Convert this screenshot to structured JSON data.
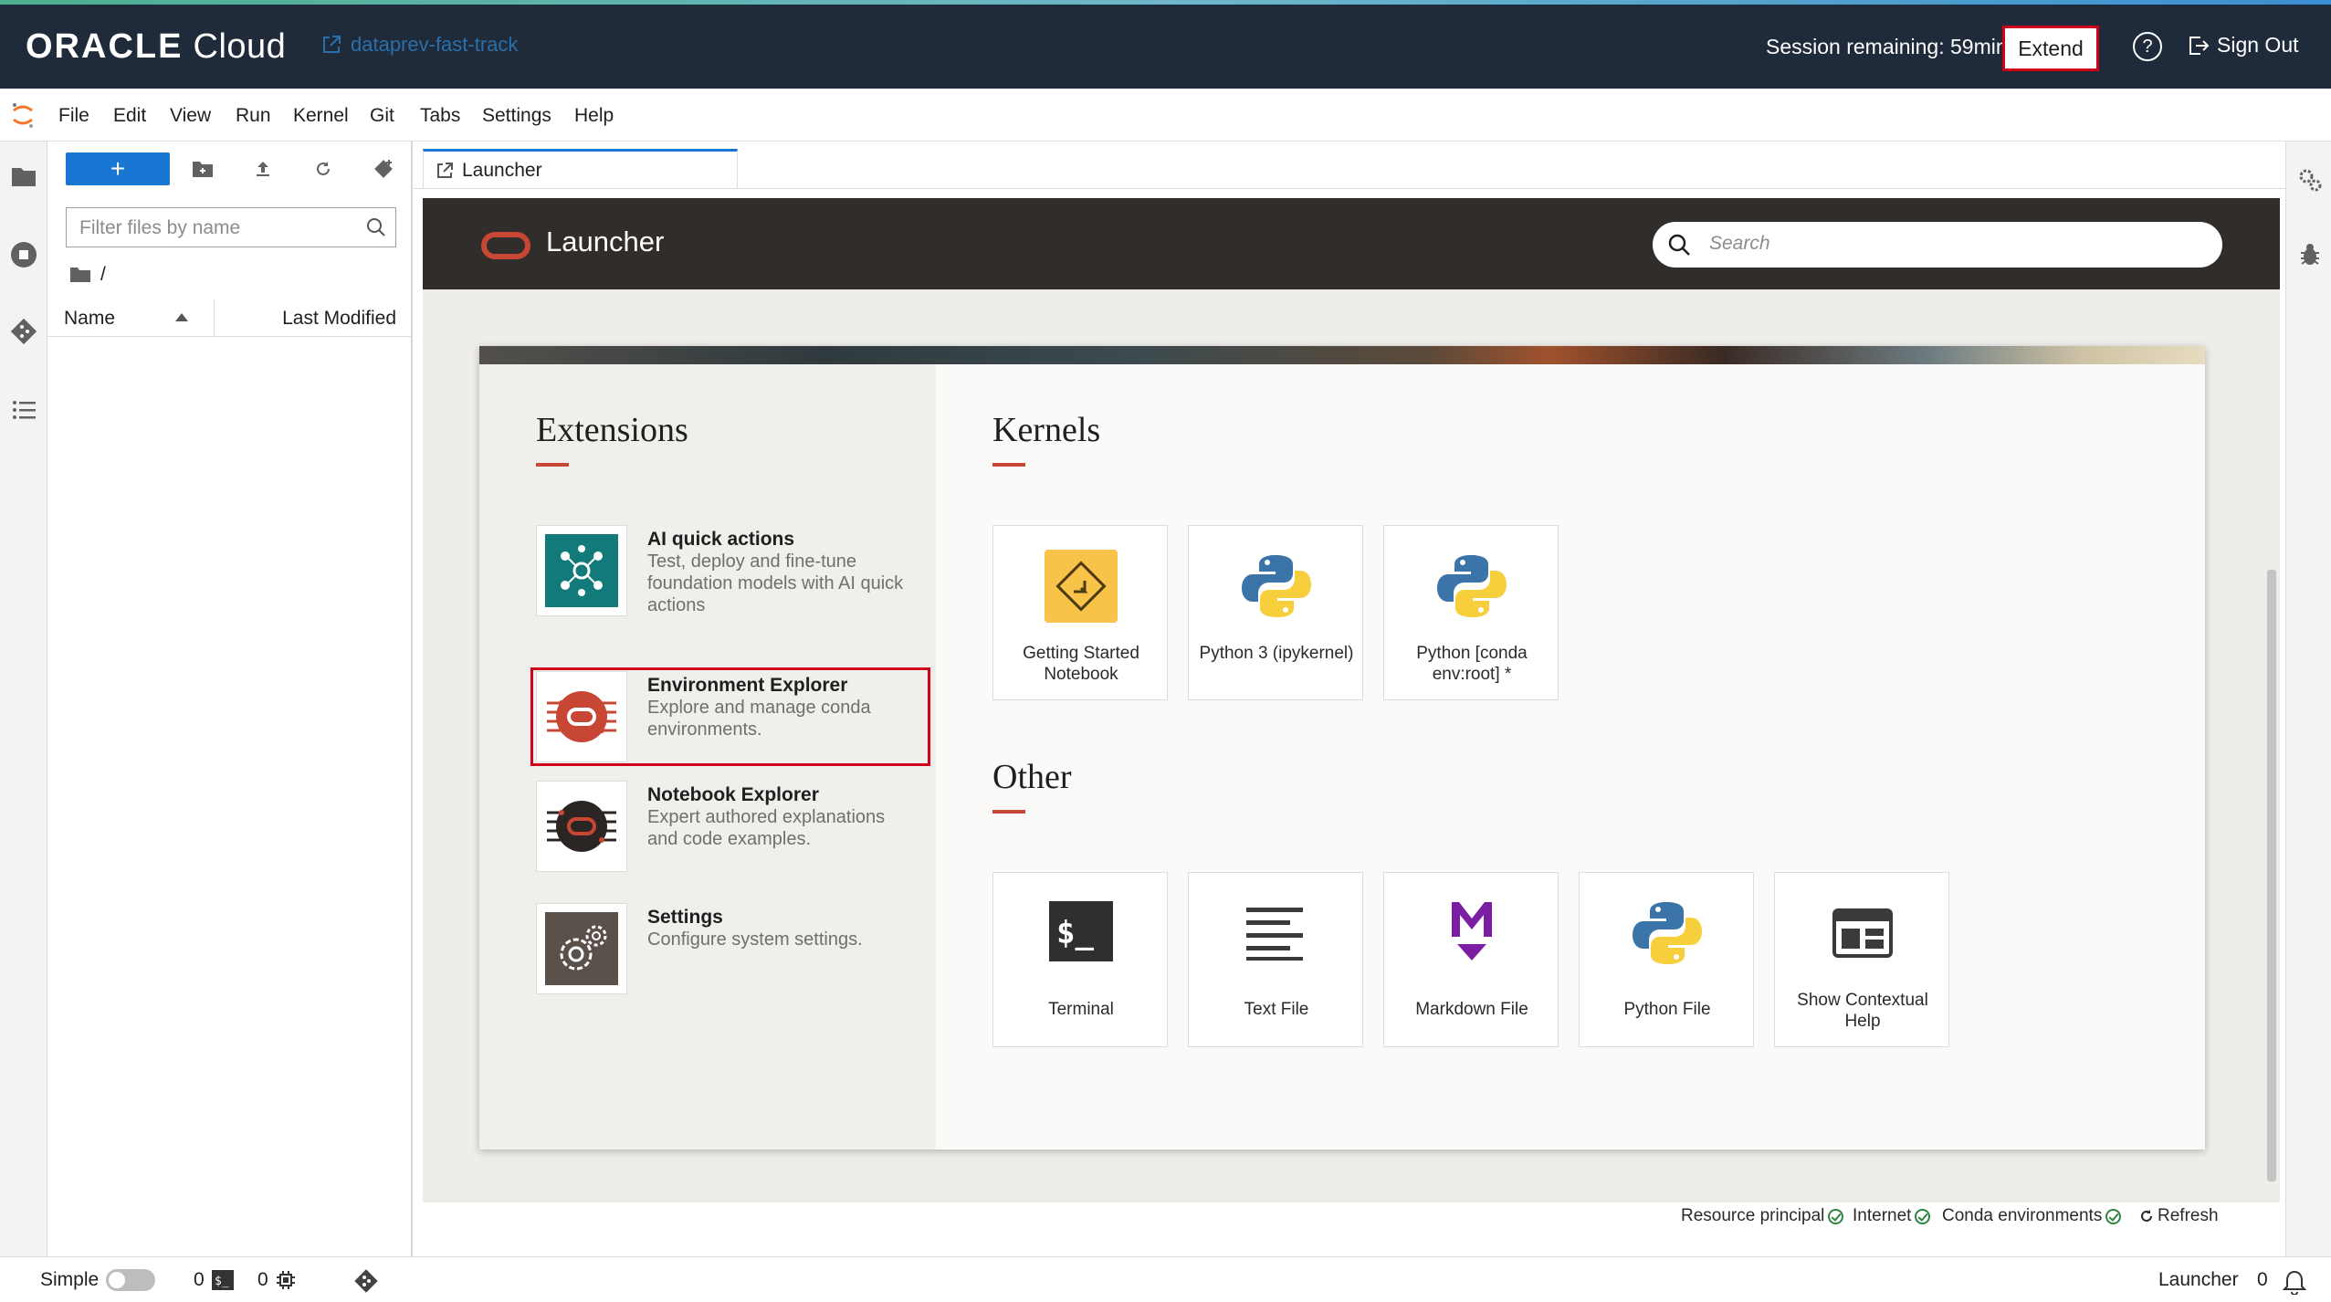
{
  "app": {
    "brand_oracle": "ORACLE",
    "brand_cloud": "Cloud",
    "project_link": "dataprev-fast-track",
    "session_text": "Session remaining: 59min",
    "extend_label": "Extend",
    "help_label": "?",
    "signout_label": "Sign Out"
  },
  "menu": [
    "File",
    "Edit",
    "View",
    "Run",
    "Kernel",
    "Git",
    "Tabs",
    "Settings",
    "Help"
  ],
  "filebrowser": {
    "new_label": "+",
    "filter_placeholder": "Filter files by name",
    "breadcrumb": "/",
    "col_name": "Name",
    "col_modified": "Last Modified"
  },
  "tab": {
    "label": "Launcher"
  },
  "launcher": {
    "title": "Launcher",
    "search_placeholder": "Search",
    "extensions_title": "Extensions",
    "kernels_title": "Kernels",
    "other_title": "Other",
    "extensions": [
      {
        "title": "AI quick actions",
        "desc": "Test, deploy and fine-tune foundation models with AI quick actions",
        "icon": "ai-quick-actions-icon"
      },
      {
        "title": "Environment Explorer",
        "desc": "Explore and manage conda environments.",
        "icon": "environment-explorer-icon"
      },
      {
        "title": "Notebook Explorer",
        "desc": "Expert authored explanations and code examples.",
        "icon": "notebook-explorer-icon"
      },
      {
        "title": "Settings",
        "desc": "Configure system settings.",
        "icon": "settings-gear-icon"
      }
    ],
    "kernels": [
      {
        "label": "Getting Started Notebook",
        "icon": "getting-started-icon"
      },
      {
        "label": "Python 3 (ipykernel)",
        "icon": "python-icon"
      },
      {
        "label": "Python [conda env:root] *",
        "icon": "python-icon"
      }
    ],
    "other": [
      {
        "label": "Terminal",
        "icon": "terminal-icon"
      },
      {
        "label": "Text File",
        "icon": "text-file-icon"
      },
      {
        "label": "Markdown File",
        "icon": "markdown-icon"
      },
      {
        "label": "Python File",
        "icon": "python-icon"
      },
      {
        "label": "Show Contextual Help",
        "icon": "help-panel-icon"
      }
    ]
  },
  "status_links": {
    "resource_principal": "Resource principal",
    "internet": "Internet",
    "conda": "Conda environments",
    "refresh": "Refresh"
  },
  "statusbar": {
    "simple_label": "Simple",
    "terminals_count": "0",
    "kernels_count": "0",
    "right_label": "Launcher",
    "notif_count": "0"
  },
  "colors": {
    "oracle_red": "#c74634",
    "highlight_red": "#d0021b",
    "primary_blue": "#1976d2",
    "header_dark": "#312d2a",
    "topbar_dark": "#1f2b3a"
  }
}
